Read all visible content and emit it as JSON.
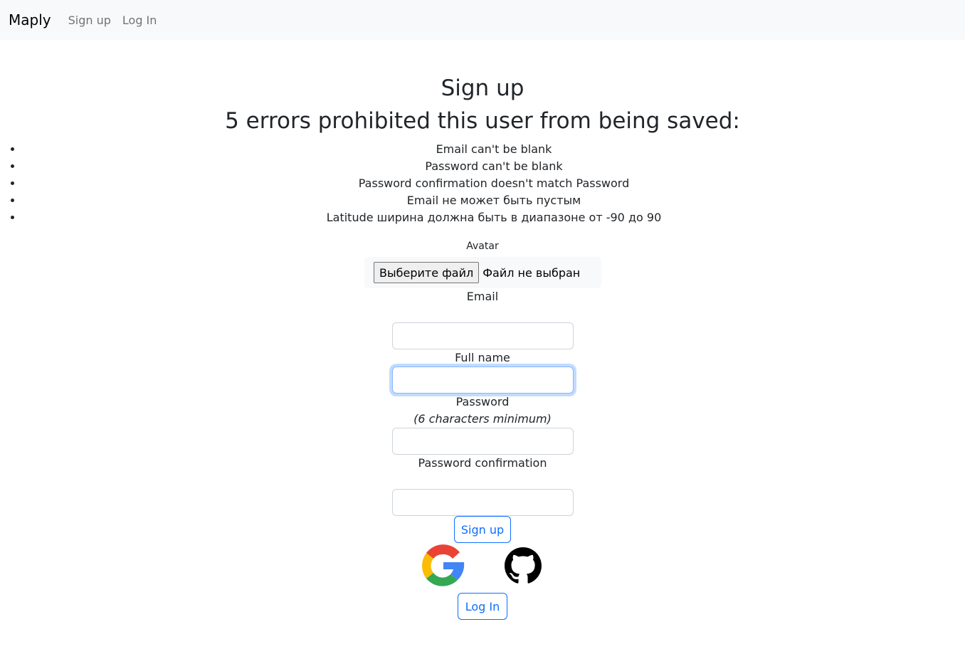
{
  "nav": {
    "brand": "Maply",
    "links": [
      "Sign up",
      "Log In"
    ]
  },
  "page": {
    "title": "Sign up",
    "error_heading": "5 errors prohibited this user from being saved:",
    "errors": [
      "Email can't be blank",
      "Password can't be blank",
      "Password confirmation doesn't match Password",
      "Email не может быть пустым",
      "Latitude ширина должна быть в диапазоне от -90 до 90"
    ]
  },
  "form": {
    "avatar_label": "Avatar",
    "file_button": "Выберите файл",
    "file_status": "Файл не выбран",
    "email_label": "Email",
    "email_value": "",
    "fullname_label": "Full name",
    "fullname_value": "",
    "password_label": "Password",
    "password_hint": "(6 characters minimum)",
    "password_value": "",
    "password_confirmation_label": "Password confirmation",
    "password_confirmation_value": "",
    "submit_label": "Sign up",
    "login_label": "Log In"
  },
  "social": {
    "icons": [
      "google-icon",
      "github-icon"
    ]
  },
  "colors": {
    "primary": "#0d6efd",
    "navbar_bg": "#f8f9fa",
    "text": "#212529"
  }
}
